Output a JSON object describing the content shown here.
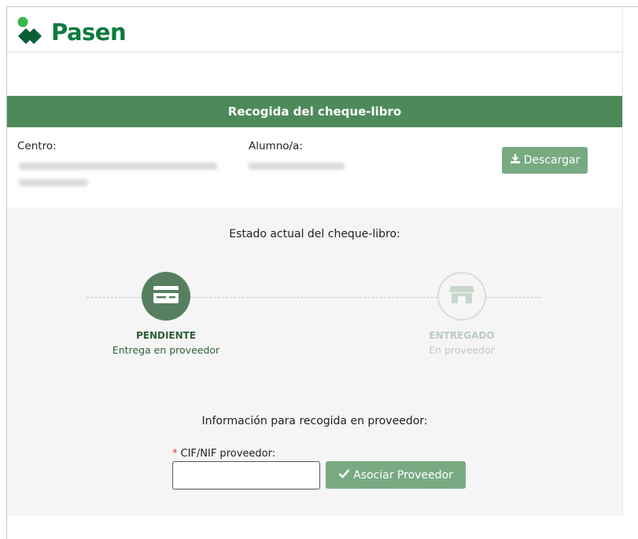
{
  "header": {
    "brand": "Pasen"
  },
  "title_bar": {
    "title": "Recogida del cheque-libro"
  },
  "info": {
    "centro_label": "Centro:",
    "alumno_label": "Alumno/a:",
    "download_label": "Descargar"
  },
  "state": {
    "title": "Estado actual del cheque-libro:",
    "steps": [
      {
        "name": "PENDIENTE",
        "sub": "Entrega en proveedor",
        "icon": "card-icon",
        "active": true
      },
      {
        "name": "ENTREGADO",
        "sub": "En proveedor",
        "icon": "store-icon",
        "active": false
      }
    ]
  },
  "pickup": {
    "title": "Información para recogida en proveedor:",
    "required_mark": "*",
    "field_label": "CIF/NIF proveedor:",
    "field_value": "",
    "associate_label": "Asociar Proveedor"
  },
  "colors": {
    "brand_green": "#0b7a3e",
    "title_bar": "#4d8a5a",
    "button": "#78aa82",
    "active_step": "#567f60",
    "inactive_step_text": "#bccbbf"
  }
}
